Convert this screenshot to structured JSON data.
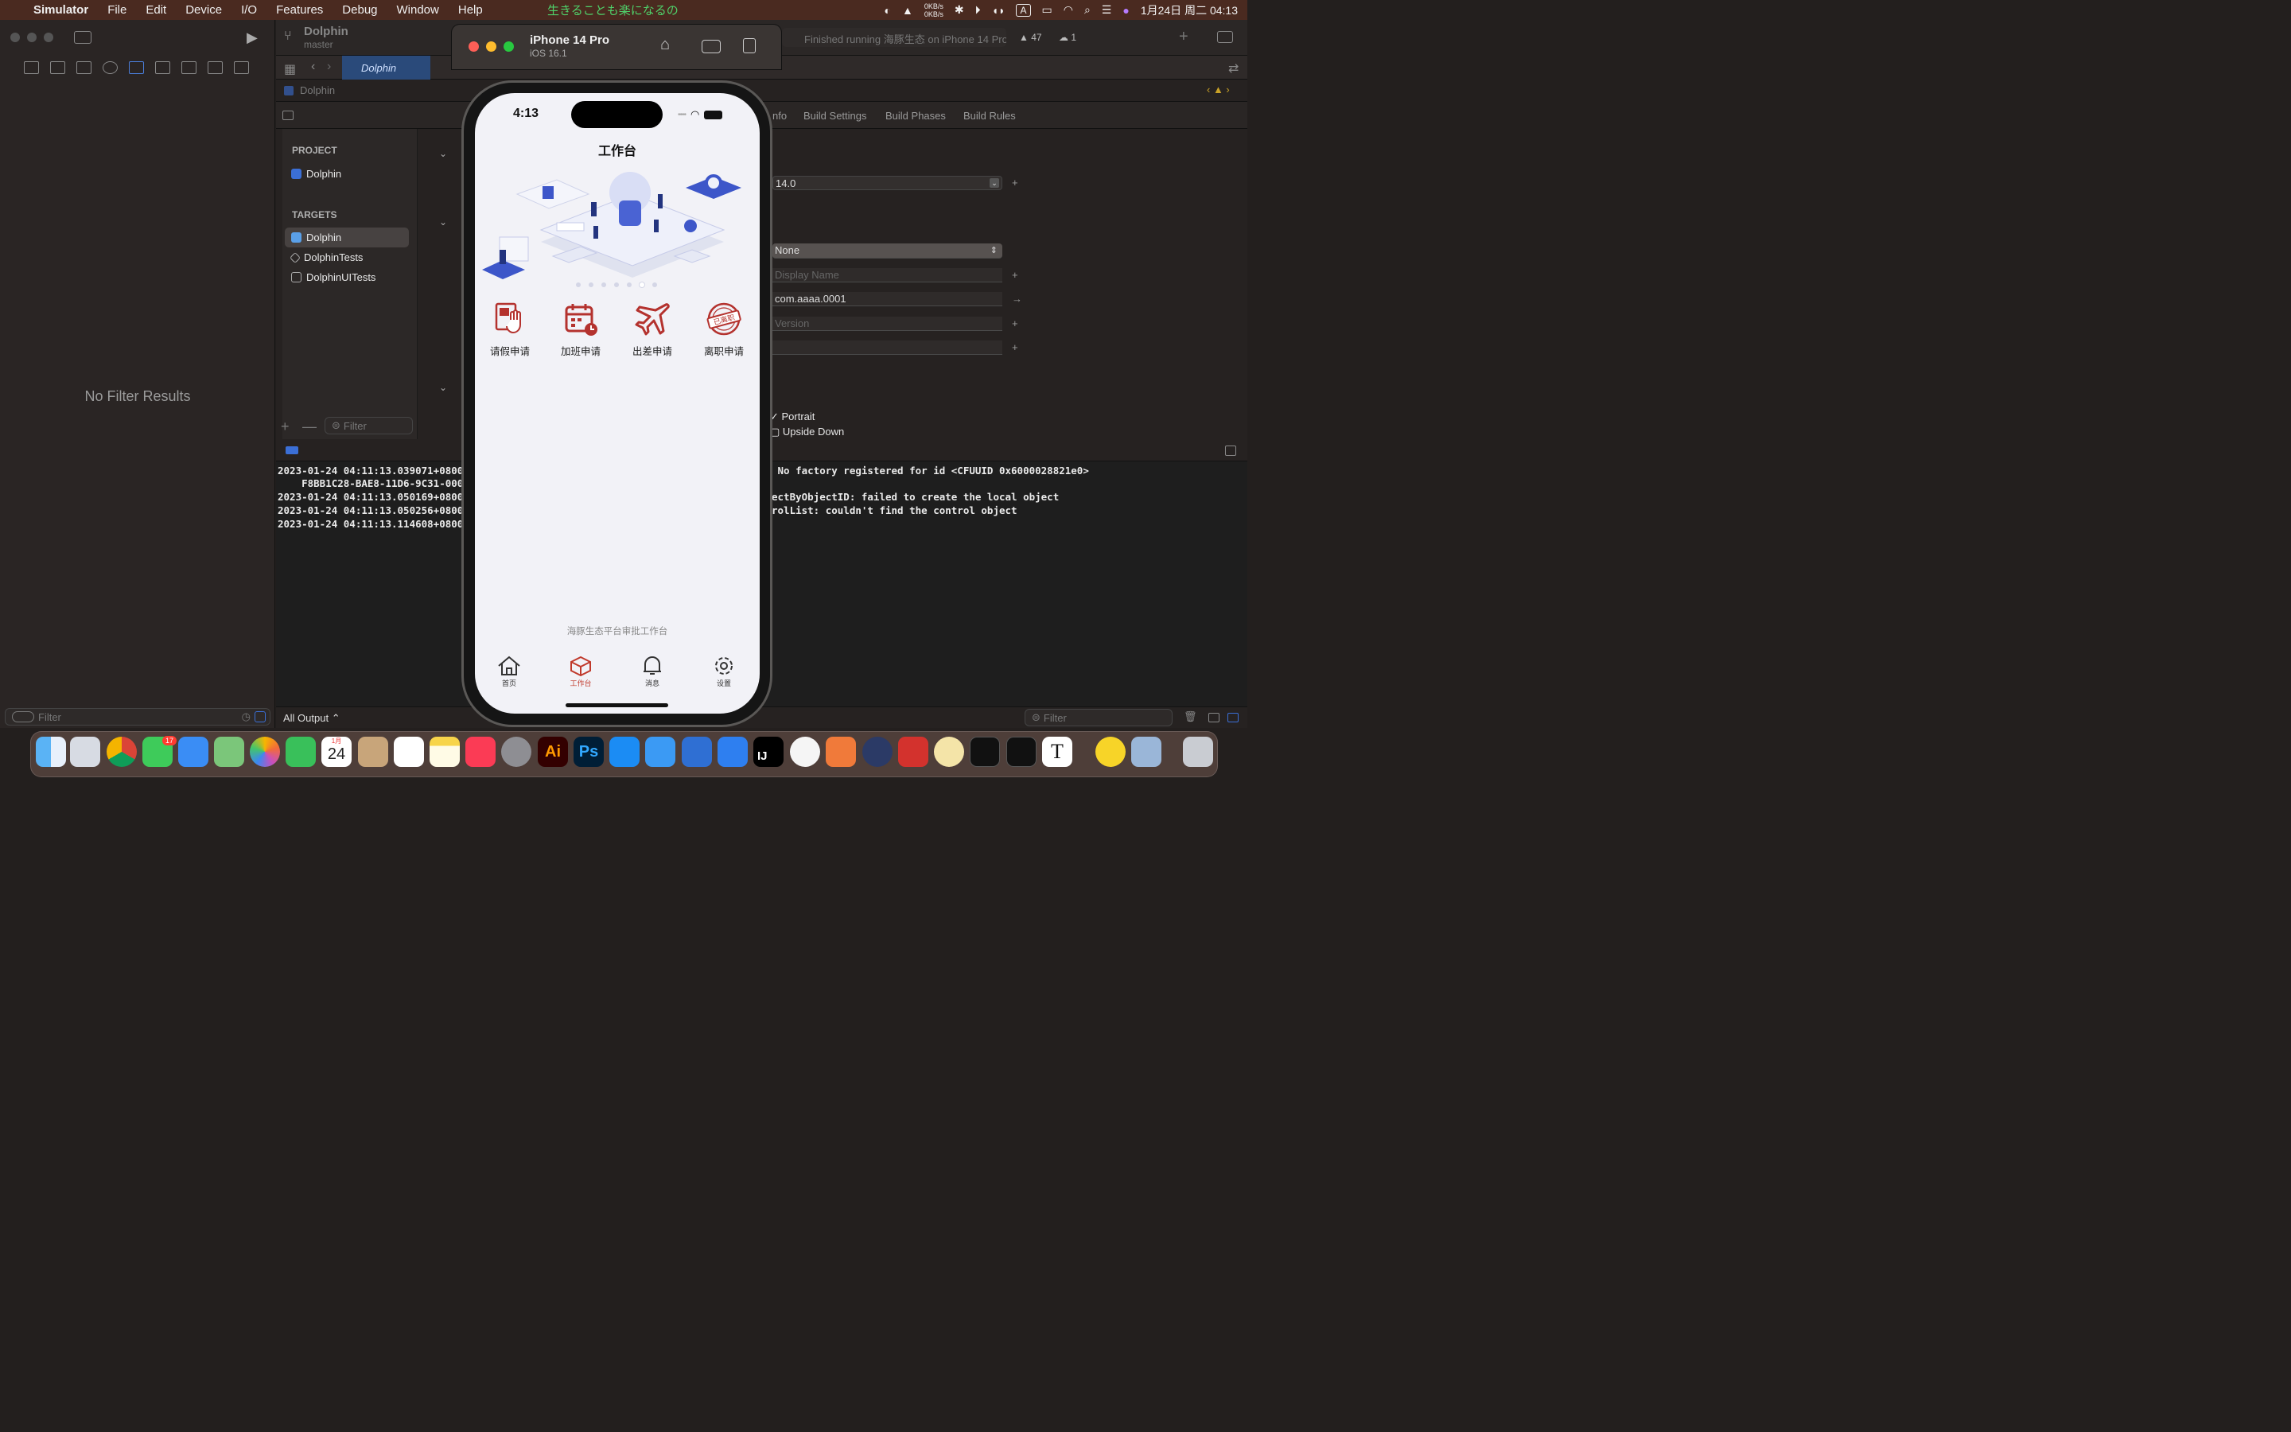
{
  "menubar": {
    "apple": "",
    "app_name": "Simulator",
    "items": [
      "File",
      "Edit",
      "Device",
      "I/O",
      "Features",
      "Debug",
      "Window",
      "Help"
    ],
    "center_text": "生きることも楽になるの",
    "net_up": "0KB/s",
    "net_down": "0KB/s",
    "input_mode": "A",
    "datetime": "1月24日 周二  04:13"
  },
  "xcode": {
    "scheme_name": "Dolphin",
    "branch": "master",
    "status_text": "Finished running 海豚生态 on iPhone 14 Pro",
    "warnings_count": "47",
    "issues_count": "1",
    "tab_label": "Dolphin",
    "jump_bar": "Dolphin",
    "settings_tabs": [
      "nfo",
      "Build Settings",
      "Build Phases",
      "Build Rules"
    ],
    "project_header": "PROJECT",
    "project_name": "Dolphin",
    "targets_header": "TARGETS",
    "targets": [
      "Dolphin",
      "DolphinTests",
      "DolphinUITests"
    ],
    "project_filter_placeholder": "Filter",
    "navigator_empty": "No Filter Results",
    "navigator_filter_placeholder": "Filter",
    "deployment_value": "14.0",
    "category_value": "None",
    "display_name_placeholder": "Display Name",
    "bundle_id_value": "com.aaaa.0001",
    "version_placeholder": "Version",
    "orientation_portrait": "Portrait",
    "orientation_upside_down": "Upside Down",
    "console_output_selector": "All Output ⌃",
    "console_filter_placeholder": "Filter",
    "console_lines_left": [
      "2023-01-24 04:11:13.039071+0800",
      "    F8BB1C28-BAE8-11D6-9C31-000",
      "2023-01-24 04:11:13.050169+0800",
      "2023-01-24 04:11:13.050256+0800",
      "2023-01-24 04:11:13.114608+0800"
    ],
    "console_lines_right": [
      " No factory registered for id <CFUUID 0x6000028821e0>",
      "ectByObjectID: failed to create the local object",
      "rolList: couldn't find the control object"
    ]
  },
  "simulator": {
    "device_name": "iPhone 14 Pro",
    "os_version": "iOS 16.1"
  },
  "phone": {
    "status_time": "4:13",
    "nav_title": "工作台",
    "carousel_total_dots": 7,
    "carousel_active_index": 5,
    "functions": [
      {
        "label": "请假申请",
        "icon": "leave-request-icon"
      },
      {
        "label": "加班申请",
        "icon": "overtime-calendar-icon"
      },
      {
        "label": "出差申请",
        "icon": "airplane-icon"
      },
      {
        "label": "离职申请",
        "icon": "resigned-stamp-icon"
      }
    ],
    "stamp_text": "已离职",
    "footer_text": "海豚生态平台审批工作台",
    "tabs": [
      {
        "label": "首页",
        "icon": "home-icon"
      },
      {
        "label": "工作台",
        "icon": "cube-icon"
      },
      {
        "label": "消息",
        "icon": "bell-icon"
      },
      {
        "label": "设置",
        "icon": "gear-icon"
      }
    ],
    "active_tab": "工作台",
    "accent_color": "#c0392b"
  },
  "dock": {
    "calendar_month": "1月",
    "calendar_day": "24",
    "messages_badge": "17",
    "apps": [
      "finder",
      "launchpad",
      "chrome",
      "messages",
      "mail",
      "maps",
      "photos",
      "facetime",
      "calendar",
      "contacts",
      "reminders",
      "notes",
      "music",
      "system-preferences",
      "illustrator",
      "photoshop",
      "app-store",
      "xcode-instruments",
      "xcode",
      "simulator",
      "intellij",
      "vpn",
      "pencil",
      "cloud",
      "kodi",
      "hamster",
      "activity-monitor",
      "terminal",
      "typora",
      "qq-music",
      "preview",
      "trash"
    ],
    "ai_label": "Ai",
    "ps_label": "Ps",
    "ij_label": "IJ",
    "typora_label": "T"
  }
}
